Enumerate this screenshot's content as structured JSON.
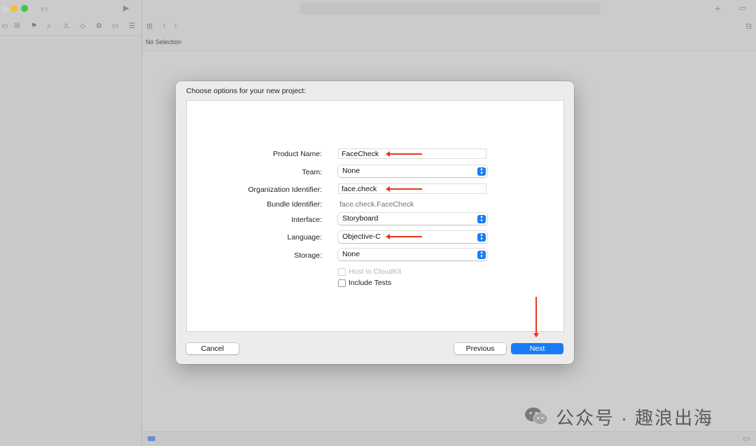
{
  "editor": {
    "no_selection": "No Selection"
  },
  "sheet": {
    "title": "Choose options for your new project:",
    "product_name_label": "Product Name:",
    "product_name_value": "FaceCheck",
    "team_label": "Team:",
    "team_value": "None",
    "org_label": "Organization Identifier:",
    "org_value": "face.check",
    "bundle_label": "Bundle Identifier:",
    "bundle_value": "face.check.FaceCheck",
    "interface_label": "Interface:",
    "interface_value": "Storyboard",
    "language_label": "Language:",
    "language_value": "Objective-C",
    "storage_label": "Storage:",
    "storage_value": "None",
    "host_cloudkit_label": "Host in CloudKit",
    "include_tests_label": "Include Tests",
    "cancel_label": "Cancel",
    "previous_label": "Previous",
    "next_label": "Next"
  },
  "watermark": {
    "text": "公众号 · 趣浪出海"
  },
  "colors": {
    "accent": "#1a7cf5",
    "annotation": "#e5371a"
  }
}
